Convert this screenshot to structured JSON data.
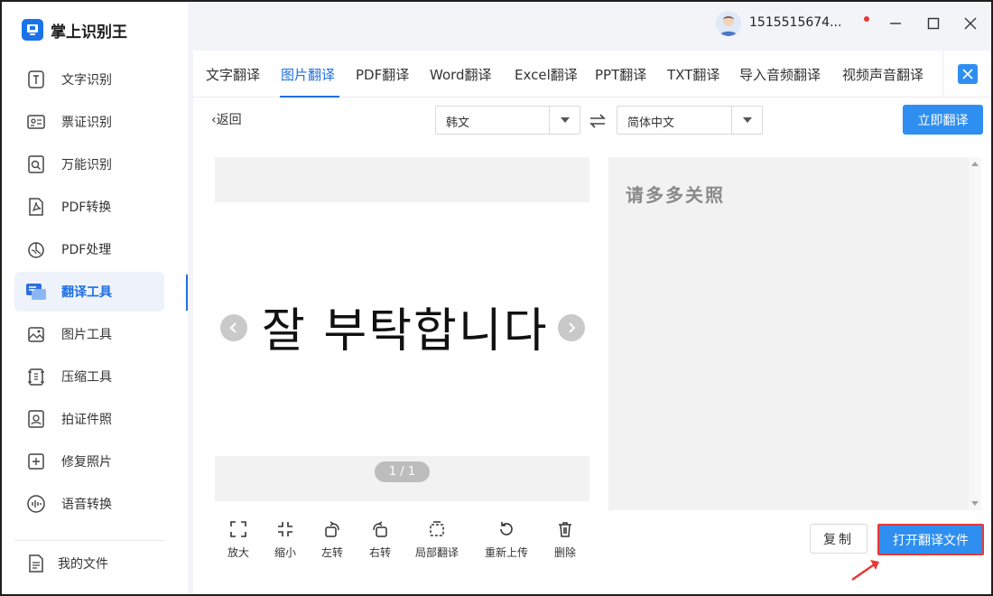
{
  "app": {
    "title": "掌上识别王"
  },
  "user": {
    "account": "1515515674..."
  },
  "sidebar": {
    "items": [
      {
        "label": "文字识别",
        "icon": "text-recognition-icon"
      },
      {
        "label": "票证识别",
        "icon": "ticket-recognition-icon"
      },
      {
        "label": "万能识别",
        "icon": "universal-recognition-icon"
      },
      {
        "label": "PDF转换",
        "icon": "pdf-convert-icon"
      },
      {
        "label": "PDF处理",
        "icon": "pdf-process-icon"
      },
      {
        "label": "翻译工具",
        "icon": "translate-tool-icon",
        "active": true
      },
      {
        "label": "图片工具",
        "icon": "image-tool-icon"
      },
      {
        "label": "压缩工具",
        "icon": "compress-tool-icon"
      },
      {
        "label": "拍证件照",
        "icon": "id-photo-icon"
      },
      {
        "label": "修复照片",
        "icon": "repair-photo-icon"
      },
      {
        "label": "语音转换",
        "icon": "voice-convert-icon"
      }
    ],
    "my_files": "我的文件"
  },
  "tabs": [
    "文字翻译",
    "图片翻译",
    "PDF翻译",
    "Word翻译",
    "Excel翻译",
    "PPT翻译",
    "TXT翻译",
    "导入音频翻译",
    "视频声音翻译"
  ],
  "active_tab": "图片翻译",
  "toolbar": {
    "back_label": "返回",
    "source_language": "韩文",
    "target_language": "简体中文",
    "translate_button": "立即翻译"
  },
  "viewer": {
    "image_text": "잘 부탁합니다",
    "page_indicator": "1 / 1"
  },
  "tools": [
    "放大",
    "缩小",
    "左转",
    "右转",
    "局部翻译",
    "重新上传",
    "删除"
  ],
  "result": {
    "text": "请多多关照",
    "copy_button": "复制",
    "open_button": "打开翻译文件"
  },
  "colors": {
    "accent": "#1e6fe3",
    "button": "#2f8ff0",
    "highlight": "#e53935"
  }
}
